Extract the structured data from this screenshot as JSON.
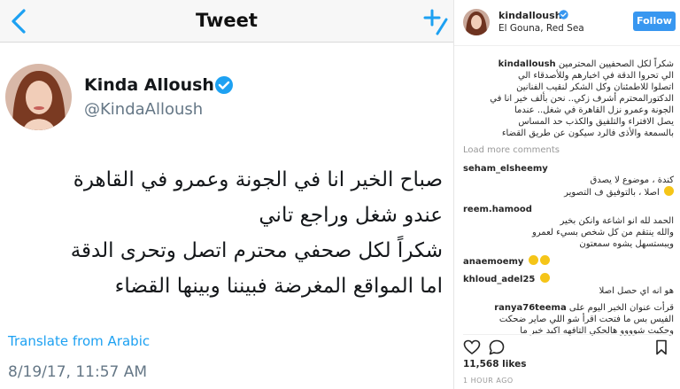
{
  "tweet": {
    "header_title": "Tweet",
    "name": "Kinda Alloush",
    "handle": "@KindaAlloush",
    "body_lines": [
      "صباح الخير انا في الجونة وعمرو في القاهرة",
      "عندو شغل وراجع تاني",
      "شكراً لكل صحفي محترم اتصل وتحرى الدقة",
      "اما المواقع المغرضة فبيننا وبينها القضاء"
    ],
    "translate_label": "Translate from Arabic",
    "timestamp": "8/19/17, 11:57 AM",
    "colors": {
      "accent": "#1da1f2",
      "text": "#14171a",
      "muted": "#657786"
    }
  },
  "instagram": {
    "username": "kindalloush",
    "location": "El Gouna, Red Sea",
    "follow_label": "Follow",
    "caption_user": "kindalloush",
    "caption_lines": [
      "شكراً لكل الصحفيين المحترمين",
      "الي تحروا الدقة في اخبارهم وللأصدقاء الي",
      "اتصلوا للاطمئنان وكل الشكر لنقيب الفنانين",
      "الدكتورالمحترم أشرف زكي.. نحن بألف خير انا في",
      "الجونة وعمرو نزل القاهرة في شغل.. عندما",
      "يصل الافتراء والتلفيق والكذب حد المساس",
      "بالسمعة والأذى فالرد سيكون عن طريق القضاء"
    ],
    "load_more_label": "Load more comments",
    "comments": [
      {
        "user": "seham_elsheemy",
        "lines": [
          "كندة ، موضوع لا يصدق",
          "اصلا ، بالتوفيق ف التصوير"
        ],
        "emoji": true
      },
      {
        "user": "reem.hamood",
        "lines": [
          "الحمد لله انو اشاعة وانكن بخير",
          "والله ينتقم من كل شخص بسيء لعمرو",
          "ويبستسهل يشوه سمعتون"
        ],
        "emoji": false
      },
      {
        "user": "anaemoemy",
        "lines": [],
        "emoji_count": 2
      },
      {
        "user": "khloud_adel25",
        "lines": [
          "هو انه اي حصل اصلا"
        ],
        "emoji_count": 1
      },
      {
        "user": "ranya76teema",
        "lines": [
          "قرأت عنوان الخبر اليوم على",
          "الفيس بس ما فتحت اقرأ شو اللي صاير ضحكت",
          "وحكيت شوووو هالحكي التافهه اكيد خبر ما"
        ],
        "emoji": false
      }
    ],
    "likes": "11,568 likes",
    "time_ago": "1 HOUR AGO",
    "colors": {
      "follow_bg": "#3897f0",
      "text": "#262626",
      "muted": "#999999"
    }
  }
}
